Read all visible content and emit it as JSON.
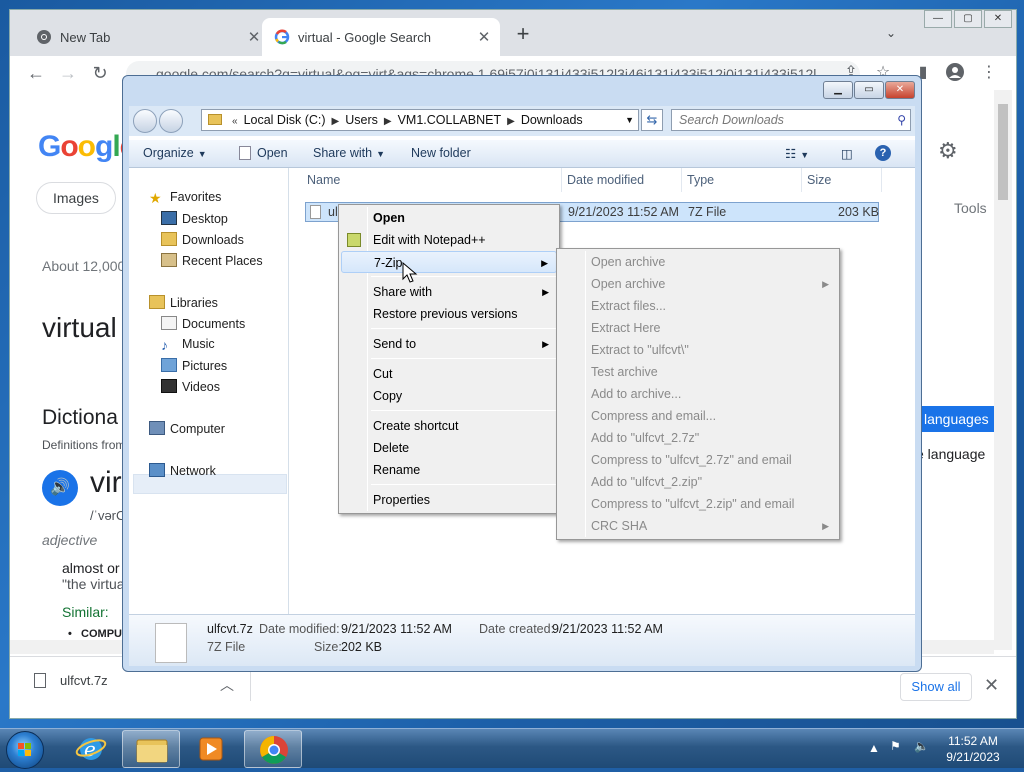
{
  "browser": {
    "tabs": [
      {
        "title": "New Tab"
      },
      {
        "title": "virtual - Google Search"
      }
    ],
    "url": "google.com/search?q=virtual&oq=virt&aqs=chrome.1.69i57j0i131i433i512l3j46i131i433i512j0i131i433i512l"
  },
  "google": {
    "logo": "Google",
    "chip_images": "Images",
    "tools": "Tools",
    "about": "About 12,000",
    "heading": "virtual",
    "dictionary": "Dictiona",
    "definitions_from": "Definitions from",
    "word": "vir",
    "pronunciation": "/ˈvərC",
    "pos": "adjective",
    "def1": "almost or",
    "def2": "\"the virtua",
    "similar": "Similar:",
    "bullet": "COMPU",
    "languages_btn": "languages",
    "language_txt": "e language"
  },
  "download": {
    "file": "ulfcvt.7z",
    "show_all": "Show all"
  },
  "explorer": {
    "path": [
      "Local Disk (C:)",
      "Users",
      "VM1.COLLABNET",
      "Downloads"
    ],
    "search_placeholder": "Search Downloads",
    "commands": {
      "organize": "Organize",
      "open": "Open",
      "share": "Share with",
      "newfolder": "New folder"
    },
    "nav": {
      "favorites": "Favorites",
      "desktop": "Desktop",
      "downloads": "Downloads",
      "recent": "Recent Places",
      "libraries": "Libraries",
      "documents": "Documents",
      "music": "Music",
      "pictures": "Pictures",
      "videos": "Videos",
      "computer": "Computer",
      "network": "Network"
    },
    "columns": {
      "name": "Name",
      "date": "Date modified",
      "type": "Type",
      "size": "Size"
    },
    "file": {
      "name": "ul",
      "date": "9/21/2023 11:52 AM",
      "type": "7Z File",
      "size": "203 KB"
    },
    "details": {
      "name": "ulfcvt.7z",
      "type": "7Z File",
      "modified_label": "Date modified:",
      "modified": "9/21/2023 11:52 AM",
      "created_label": "Date created:",
      "created": "9/21/2023 11:52 AM",
      "size_label": "Size:",
      "size": "202 KB"
    }
  },
  "context_menu": {
    "items": [
      "Open",
      "Edit with Notepad++",
      "7-Zip",
      "Share with",
      "Restore previous versions",
      "Send to",
      "Cut",
      "Copy",
      "Create shortcut",
      "Delete",
      "Rename",
      "Properties"
    ]
  },
  "sevenzip_menu": {
    "items": [
      "Open archive",
      "Open archive",
      "Extract files...",
      "Extract Here",
      "Extract to \"ulfcvt\\\"",
      "Test archive",
      "Add to archive...",
      "Compress and email...",
      "Add to \"ulfcvt_2.7z\"",
      "Compress to \"ulfcvt_2.7z\" and email",
      "Add to \"ulfcvt_2.zip\"",
      "Compress to \"ulfcvt_2.zip\" and email",
      "CRC SHA"
    ]
  },
  "taskbar": {
    "time": "11:52 AM",
    "date": "9/21/2023"
  },
  "colors": {
    "accent": "#1a73e8",
    "selection": "#cde4fb"
  }
}
